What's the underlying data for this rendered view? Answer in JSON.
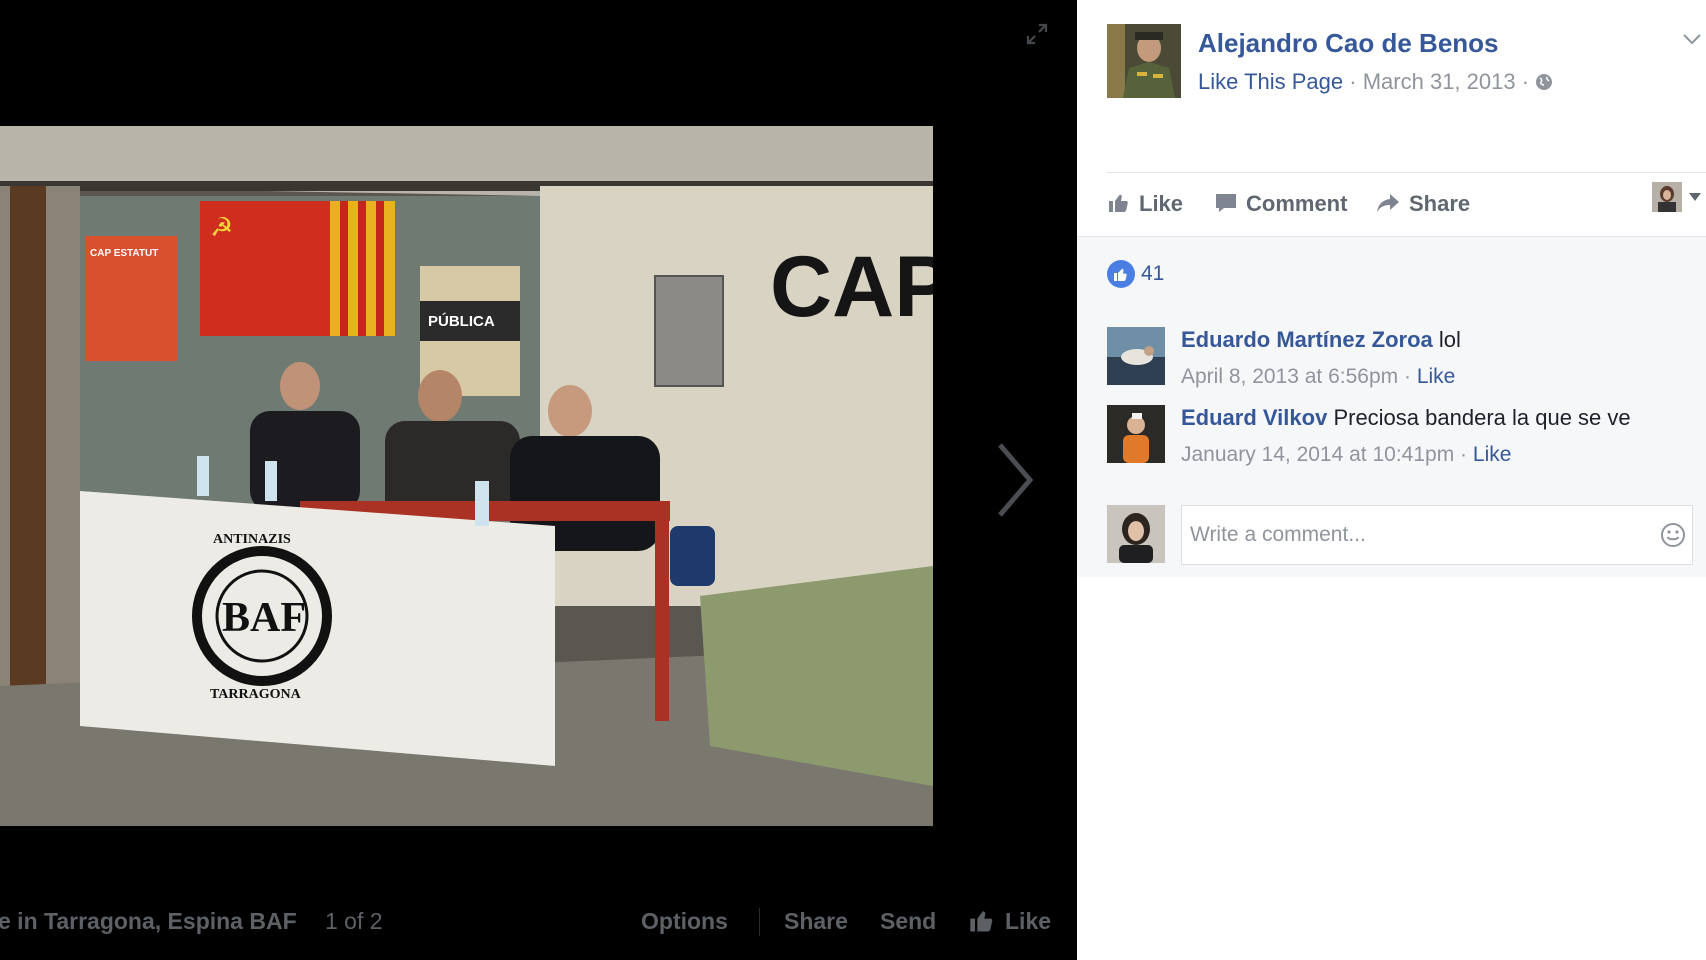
{
  "viewer": {
    "bottom_bar": {
      "caption": "e in Tarragona, Espina BAF",
      "counter": "1 of 2",
      "options": "Options",
      "share": "Share",
      "send": "Send",
      "like": "Like"
    },
    "photo": {
      "wall_text": "CAPIT",
      "poster_text_1": "CAP ESTATUT",
      "poster_text_2": "PÚBLICA",
      "banner_top": "ANTINAZIS",
      "banner_mid": "BAF",
      "banner_bottom": "TARRAGONA"
    }
  },
  "panel": {
    "page_name": "Alejandro Cao de Benos",
    "like_page": "Like This Page",
    "date": "March 31, 2013",
    "separator": "·",
    "actions": {
      "like": "Like",
      "comment": "Comment",
      "share": "Share"
    },
    "like_count": "41",
    "comments": [
      {
        "name": "Eduardo Martínez Zoroa",
        "text": "lol",
        "time": "April 8, 2013 at 6:56pm",
        "like": "Like"
      },
      {
        "name": "Eduard Vilkov",
        "text": "Preciosa bandera la que se ve",
        "time": "January 14, 2014 at 10:41pm",
        "like": "Like"
      }
    ],
    "write_placeholder": "Write a comment..."
  },
  "colors": {
    "link": "#365899",
    "meta": "#90949c",
    "viewer_bg": "#000000",
    "like_blue": "#4a7ee3"
  }
}
